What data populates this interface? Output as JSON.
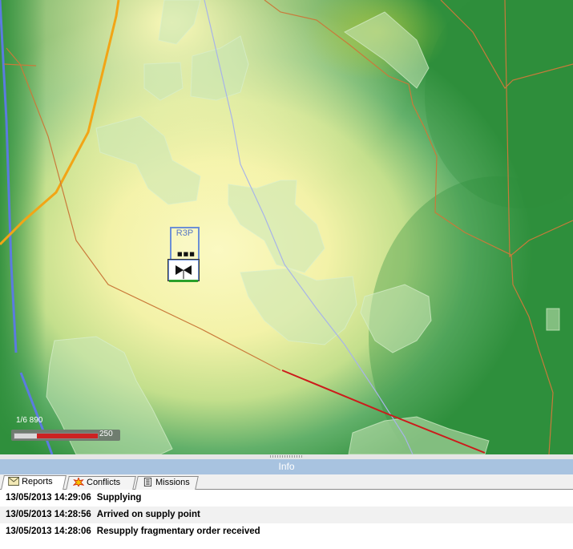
{
  "map": {
    "unit": {
      "code": "R3P",
      "echelon": "■■■",
      "status_color": "#2aa02a",
      "icon": "supply-unit-icon"
    },
    "scale": {
      "label": "1/6 890",
      "value": "250",
      "fill_color": "#cc2222"
    },
    "colors": {
      "lowland": "#fbf8b8",
      "midland": "#c8e08a",
      "highland": "#2f8f3c",
      "forest": "#bfe0b0",
      "road_major": "#f2a516",
      "road_minor": "#c97a3a",
      "river": "#5b7be0",
      "route": "#cc1b1b"
    }
  },
  "panel": {
    "title": "Info",
    "tabs": [
      {
        "label": "Reports",
        "icon": "envelope-icon",
        "active": true
      },
      {
        "label": "Conflicts",
        "icon": "explosion-icon",
        "active": false
      },
      {
        "label": "Missions",
        "icon": "document-icon",
        "active": false
      }
    ],
    "reports": [
      {
        "time": "13/05/2013 14:29:06",
        "message": "Supplying"
      },
      {
        "time": "13/05/2013 14:28:56",
        "message": "Arrived on supply point"
      },
      {
        "time": "13/05/2013 14:28:06",
        "message": "Resupply fragmentary order received"
      }
    ]
  }
}
